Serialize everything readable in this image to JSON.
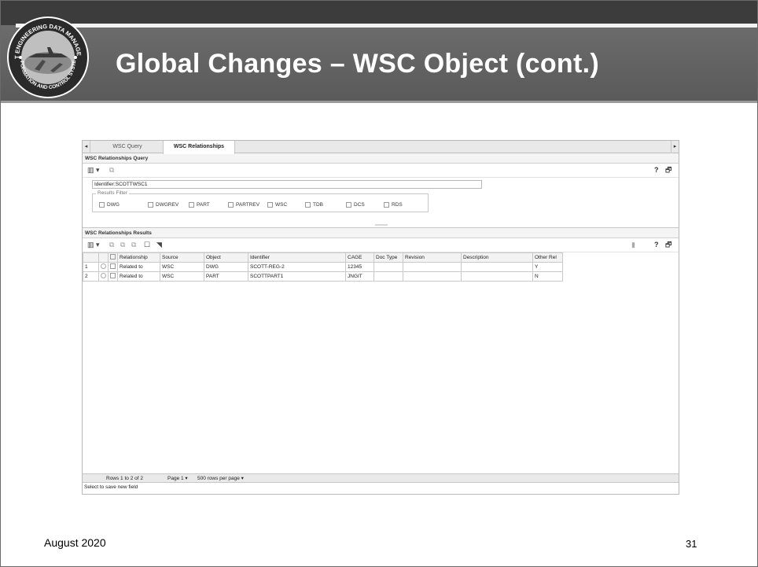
{
  "slide": {
    "title": "Global Changes – WSC Object (cont.)",
    "date": "August 2020",
    "page_number": "31",
    "logo_text_top": "JOINT ENGINEERING DATA MANAGEMENT",
    "logo_text_bottom": "INFORMATION AND CONTROL SYSTEM"
  },
  "app": {
    "tabs": [
      {
        "label": "WSC Query",
        "active": false
      },
      {
        "label": "WSC Relationships",
        "active": true
      }
    ],
    "query_section": {
      "title": "WSC Relationships Query",
      "identifier_value": "Identifier:SCOTTWSC1",
      "results_filter_label": "Results Filter",
      "filters": [
        "DWG",
        "DWGREV",
        "PART",
        "PARTREV",
        "WSC",
        "TDB",
        "DCS",
        "RDS"
      ],
      "help_label": "?"
    },
    "results_section": {
      "title": "WSC Relationships Results",
      "columns": [
        "Relationship",
        "Source",
        "Object",
        "Identifier",
        "CAGE",
        "Doc Type",
        "Revision",
        "Description",
        "Other Rel"
      ],
      "rows": [
        {
          "num": "1",
          "relationship": "Related to",
          "source": "WSC",
          "object": "DWG",
          "identifier": "SCOTT-REG-2",
          "cage": "12345",
          "doc_type": "",
          "revision": "",
          "description": "",
          "other_rel": "Y"
        },
        {
          "num": "2",
          "relationship": "Related to",
          "source": "WSC",
          "object": "PART",
          "identifier": "SCOTTPART1",
          "cage": "JNGIT",
          "doc_type": "",
          "revision": "",
          "description": "",
          "other_rel": "N"
        }
      ],
      "footer": {
        "rows_text": "Rows 1 to 2 of 2",
        "page_text": "Page 1",
        "rows_per_page_text": "500 rows per page"
      }
    },
    "status_text": "Select to save new field"
  }
}
